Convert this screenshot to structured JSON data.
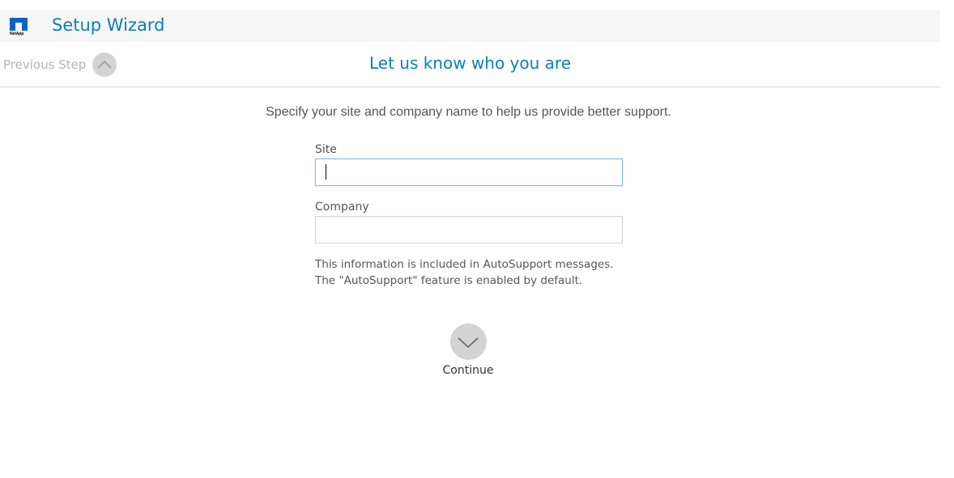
{
  "header": {
    "logo_text": "NetApp",
    "title": "Setup Wizard"
  },
  "nav": {
    "previous_label": "Previous Step",
    "step_title": "Let us know who you are"
  },
  "main": {
    "instruction": "Specify your site and company name to help us provide better support.",
    "fields": [
      {
        "label": "Site",
        "value": "",
        "placeholder": ""
      },
      {
        "label": "Company",
        "value": "",
        "placeholder": ""
      }
    ],
    "note_line1": "This information is included in AutoSupport messages.",
    "note_line2": "The \"AutoSupport\" feature is enabled by default."
  },
  "actions": {
    "continue_label": "Continue"
  },
  "icons": {
    "logo": "netapp-logo-icon",
    "previous": "chevron-up-icon",
    "continue": "chevron-down-icon"
  },
  "colors": {
    "accent": "#0b7fb5",
    "header_bg": "#f6f6f6",
    "circle_bg": "#d3d3d3"
  }
}
